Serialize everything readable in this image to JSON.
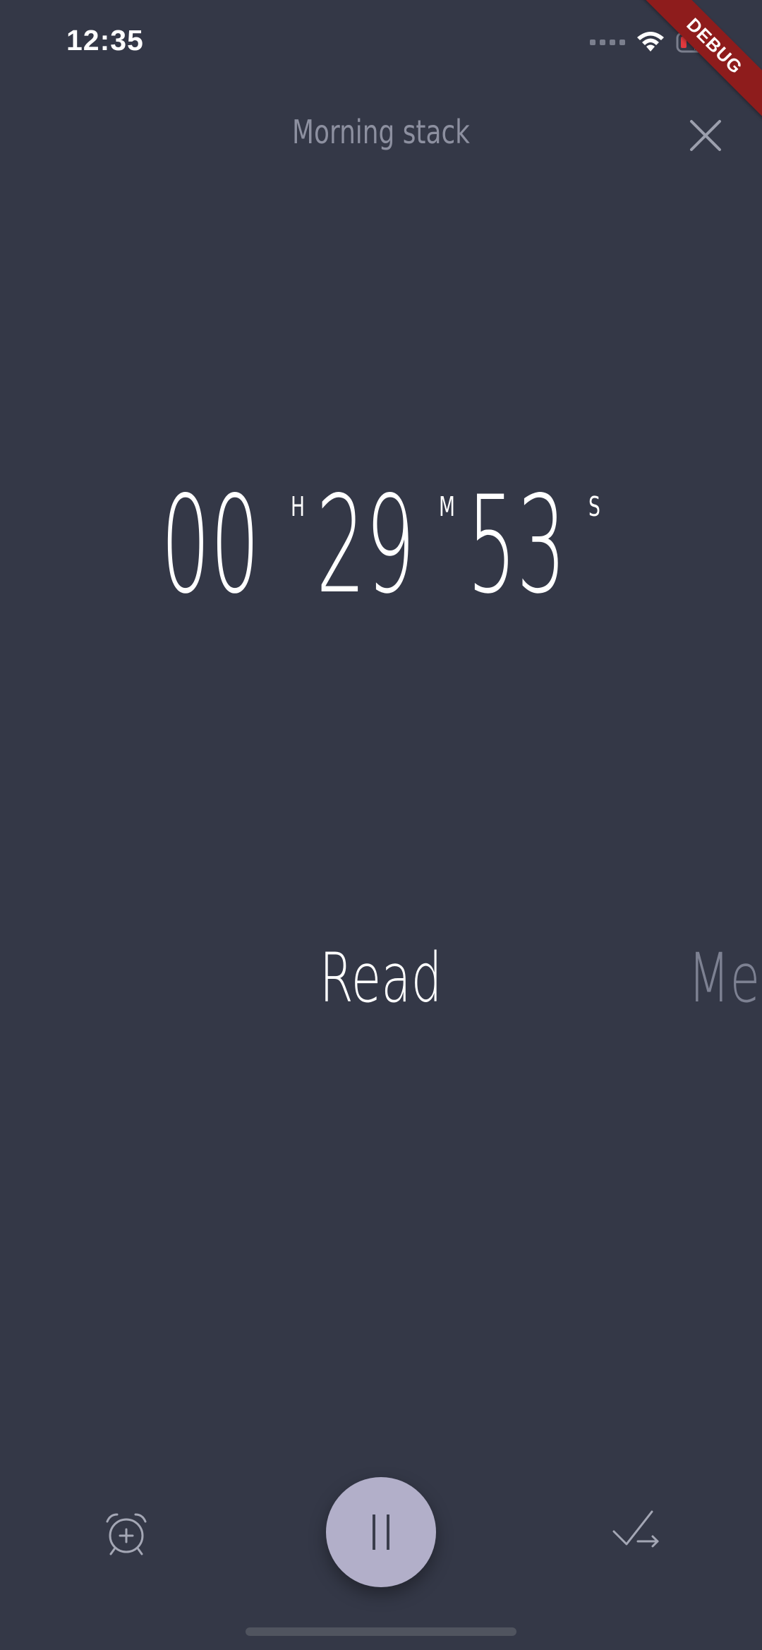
{
  "status_bar": {
    "time": "12:35",
    "icons": [
      "signal-icon",
      "wifi-icon",
      "battery-charging-icon"
    ]
  },
  "debug_banner": "DEBUG",
  "header": {
    "title": "Morning stack",
    "close_icon": "close-icon"
  },
  "timer": {
    "hours": "00",
    "hours_unit": "H",
    "minutes": "29",
    "minutes_unit": "M",
    "seconds": "53",
    "seconds_unit": "S"
  },
  "activities": {
    "current": "Read",
    "next_partial": "Med"
  },
  "controls": {
    "alarm_icon": "add-alarm-icon",
    "pause_icon": "pause-icon",
    "done_icon": "check-next-icon"
  },
  "colors": {
    "background": "#343847",
    "accent": "#b2afc9",
    "muted_text": "#8d90a0",
    "debug": "#8e1c1c"
  }
}
